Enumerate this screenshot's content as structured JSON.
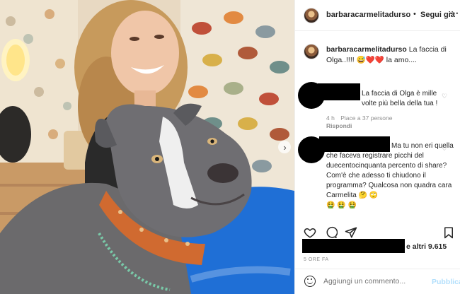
{
  "post_author": {
    "username": "barbaracarmelitadurso",
    "separator": "•",
    "follow_label": "Segui già"
  },
  "caption": {
    "username": "barbaracarmelitadurso",
    "text": "La faccia di Olga..!!!!",
    "text_tail": "la amo....",
    "emojis": [
      "😅",
      "❤️",
      "❤️"
    ]
  },
  "comments": [
    {
      "text": "La faccia di Olga è mille volte più bella della tua !",
      "time": "4 h",
      "likes_text": "Piace a 37 persone",
      "reply_label": "Rispondi"
    },
    {
      "text": "Ma tu non eri quella che faceva registrare picchi del duecentocinquanta percento di share? Com'è che adesso ti chiudono il programma? Qualcosa non quadra cara Carmelita",
      "emojis_inline": "🤔 🙄",
      "emojis_tail": "🤮 🤮 🤮"
    }
  ],
  "likes": {
    "suffix": "e altri 9.615"
  },
  "post_time": "5 ORE FA",
  "comment_box": {
    "placeholder": "Aggiungi un commento...",
    "publish_label": "Pubblica"
  },
  "colors": {
    "link_blue": "#b2dffc",
    "heart_red": "#ed4956",
    "muted": "#8e8e8e"
  },
  "icons": [
    "heart-icon",
    "comment-icon",
    "share-icon",
    "bookmark-icon",
    "emoji-icon",
    "chevron-right-icon"
  ]
}
